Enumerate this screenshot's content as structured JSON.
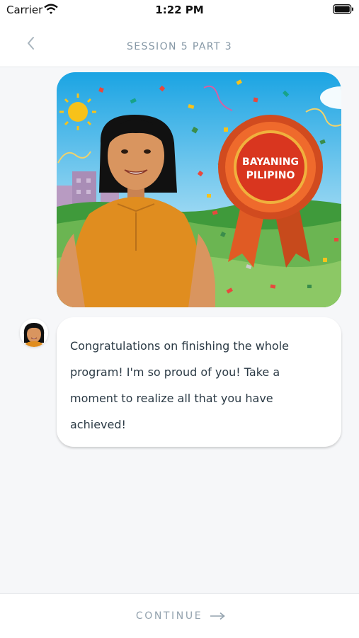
{
  "status_bar": {
    "carrier": "Carrier",
    "time": "1:22 PM",
    "icons": [
      "wifi-icon",
      "battery-icon"
    ]
  },
  "nav": {
    "title": "SESSION 5 PART 3",
    "back_icon": "chevron-left-icon"
  },
  "illustration": {
    "ribbon_text_line1": "BAYANING",
    "ribbon_text_line2": "PILIPINO"
  },
  "chat": {
    "avatar": "coach-avatar",
    "message": "Congratulations on finishing the whole program! I'm so proud of you! Take a moment to realize all that you have achieved!"
  },
  "footer": {
    "continue_label": "CONTINUE",
    "continue_icon": "arrow-right-icon"
  },
  "colors": {
    "accent": "#93a2ae",
    "title": "#8597a5",
    "text": "#2b3a45",
    "background": "#f6f7f9"
  }
}
